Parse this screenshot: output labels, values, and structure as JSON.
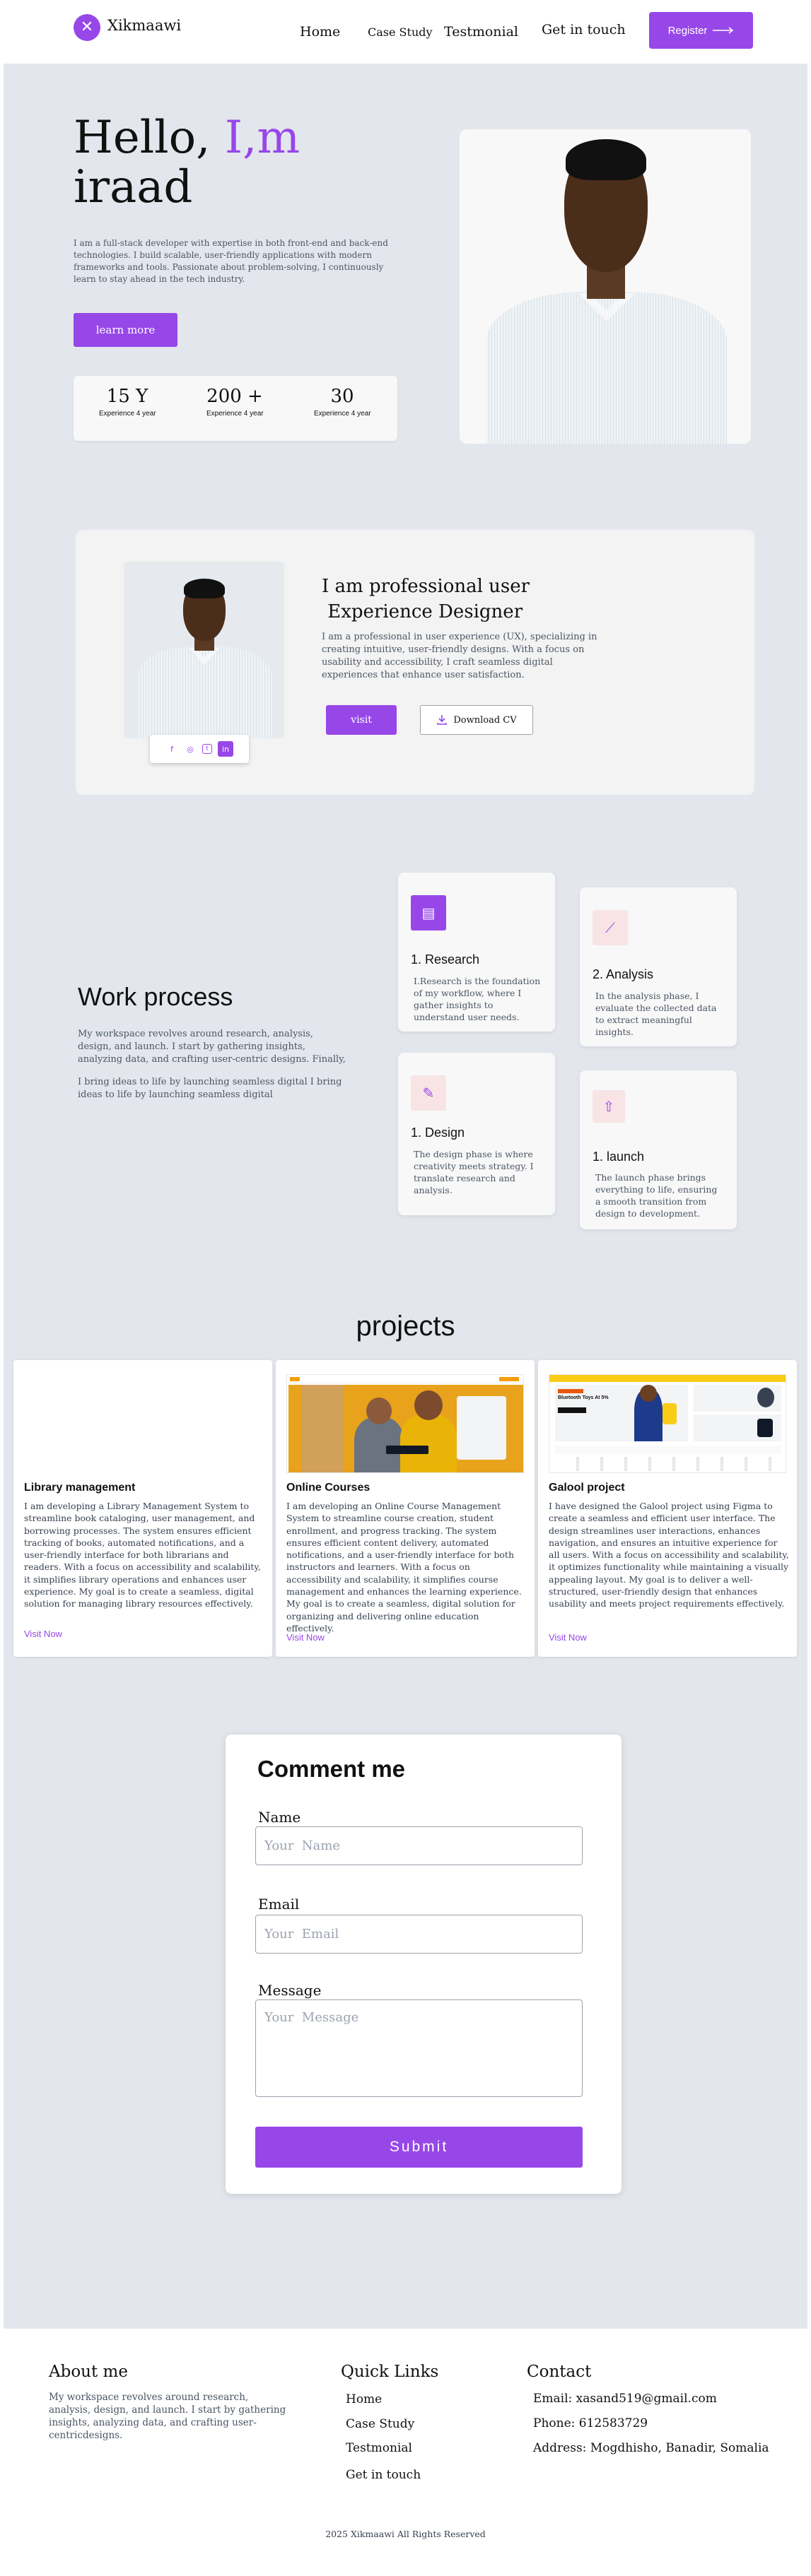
{
  "header": {
    "logo_text": "Xikmaawi",
    "logo_icon": "x-icon",
    "nav": [
      "Home",
      "Case Study",
      "Testmonial",
      "Get in touch"
    ],
    "register_label": "Register"
  },
  "hero": {
    "title_1": "Hello, ",
    "title_accent": "I,m",
    "title_2": "iraad",
    "description": "I am a full-stack developer with expertise in both front-end and back-end technologies. I build scalable, user-friendly applications with modern frameworks and tools. Passionate about problem-solving, I continuously learn to stay ahead in the tech industry.",
    "button_label": "learn more",
    "stats": [
      {
        "value": "15 Y",
        "label": "Experience  4 year"
      },
      {
        "value": "200 +",
        "label": "Experience  4 year"
      },
      {
        "value": "30",
        "label": "Experience  4 year"
      }
    ]
  },
  "about": {
    "title_1": "I am professional user",
    "title_2": " Experience Designer",
    "description": "I am a professional in user experience (UX), specializing in creating intuitive, user-friendly designs. With a focus on usability and accessibility, I craft seamless digital experiences that enhance user satisfaction.",
    "visit_label": "visit",
    "cv_label": "Download CV",
    "social_icons": [
      "facebook-icon",
      "instagram-icon",
      "twitter-icon",
      "linkedin-icon"
    ]
  },
  "work_process": {
    "title": "Work process",
    "description": "My workspace revolves around research, analysis, design, and launch. I start by gathering insights, analyzing data, and crafting user-centric designs. Finally,",
    "description_2": "I bring ideas to life by launching seamless digital  I bring ideas to life by launching seamless digital",
    "steps": [
      {
        "name": "1. Research",
        "text": "I.Research is the foundation of my workflow, where I gather insights to understand user needs.",
        "icon": "research-icon"
      },
      {
        "name": "2. Analysis",
        "text": "In the analysis phase, I evaluate the collected data to extract meaningful insights.",
        "icon": "chart-icon"
      },
      {
        "name": "1. Design",
        "text": "The design phase is where creativity meets strategy. I translate research and analysis.",
        "icon": "pencil-icon"
      },
      {
        "name": "1. launch",
        "text": "The launch phase brings everything to life, ensuring a smooth transition from design to development.",
        "icon": "launch-icon"
      }
    ]
  },
  "projects": {
    "title": "projects",
    "items": [
      {
        "name": "Library management",
        "description": "I am developing a Library Management System to streamline book cataloging, user management, and borrowing processes. The system ensures efficient tracking of books, automated notifications, and a user-friendly interface for both librarians and readers. With a focus on accessibility and scalability, it simplifies library operations and enhances user experience. My goal is to create a seamless, digital solution for managing library resources effectively.",
        "link": "Visit Now"
      },
      {
        "name": "Online Courses",
        "description": "I am developing an Online Course Management System to streamline course creation, student enrollment, and progress tracking. The system ensures efficient content delivery, automated notifications, and a user-friendly interface for both instructors and learners. With a focus on accessibility and scalability, it simplifies course management and enhances the learning experience. My goal is to create a seamless, digital solution for organizing and delivering online education effectively.",
        "link": "Visit Now"
      },
      {
        "name": "Galool project",
        "description": "I have designed the Galool project using Figma to create a seamless and efficient user interface. The design streamlines user interactions, enhances navigation, and ensures an intuitive experience for all users. With a focus on accessibility and scalability, it optimizes functionality while maintaining a visually appealing layout. My goal is to deliver a well-structured, user-friendly design that enhances usability and meets project requirements effectively.",
        "link": "Visit Now",
        "mock_text": "Bluetooth Toys At 5%"
      }
    ]
  },
  "comment": {
    "title": "Comment me",
    "name_label": "Name",
    "name_placeholder": "Your  Name",
    "email_label": "Email",
    "email_placeholder": "Your  Email",
    "message_label": "Message",
    "message_placeholder": "Your  Message",
    "submit_label": "Submit"
  },
  "footer": {
    "about_title": "About me",
    "about_text": "My workspace revolves around research, analysis, design, and launch. I start by gathering insights, analyzing data, and crafting user-centricdesigns.",
    "links_title": "Quick Links",
    "links": [
      "Home",
      "Case Study",
      "Testmonial",
      "Get in touch"
    ],
    "contact_title": "Contact",
    "email": "Email: xasand519@gmail.com",
    "phone": "Phone: 612583729",
    "address": "Address: Mogdhisho, Banadir, Somalia",
    "copyright": "2025 Xikmaawi All Rights Reserved"
  },
  "colors": {
    "accent": "#9747e8",
    "section_bg": "#e3e7ed",
    "card_bg": "#f8f8f8"
  }
}
